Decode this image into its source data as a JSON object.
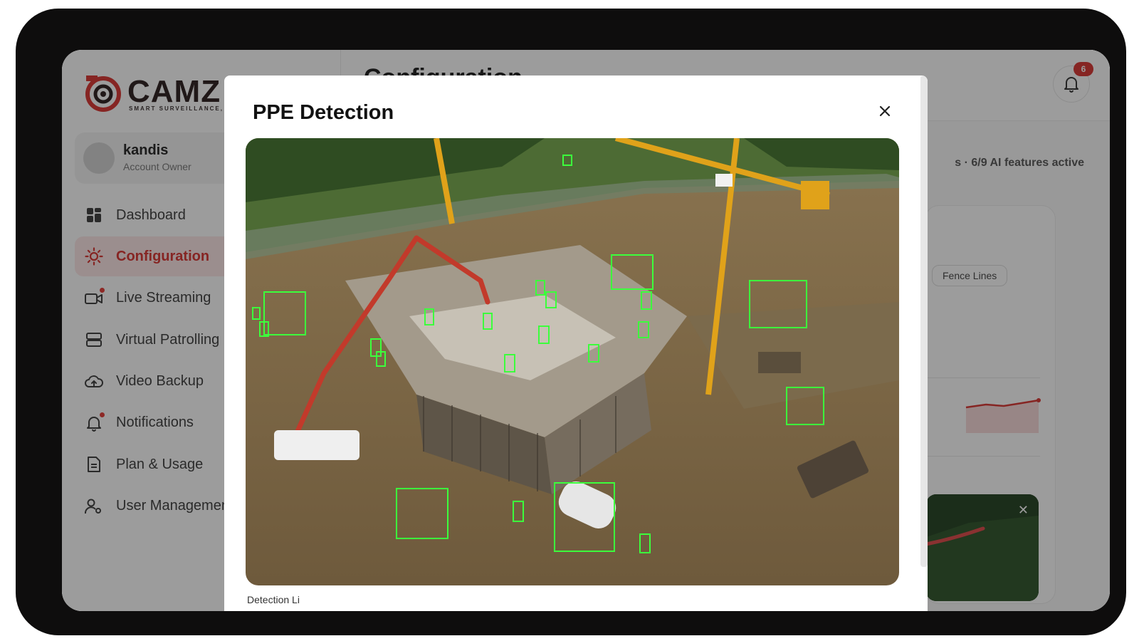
{
  "brand": {
    "name": "CAMZ",
    "tagline": "SMART SURVEILLANCE, S"
  },
  "account": {
    "name": "kandis",
    "role": "Account Owner"
  },
  "nav": [
    {
      "label": "Dashboard",
      "icon": "dashboard-icon",
      "active": false
    },
    {
      "label": "Configuration",
      "icon": "gear-icon",
      "active": true
    },
    {
      "label": "Live Streaming",
      "icon": "video-camera-icon",
      "active": false,
      "dot": true
    },
    {
      "label": "Virtual Patrolling",
      "icon": "server-icon",
      "active": false
    },
    {
      "label": "Video Backup",
      "icon": "cloud-upload-icon",
      "active": false
    },
    {
      "label": "Notifications",
      "icon": "bell-icon",
      "active": false,
      "dot": true
    },
    {
      "label": "Plan & Usage",
      "icon": "document-icon",
      "active": false
    },
    {
      "label": "User Managemen",
      "icon": "user-settings-icon",
      "active": false
    }
  ],
  "header": {
    "title": "Configuration",
    "notification_count": "6"
  },
  "status": {
    "features_text": "s · 6/9 AI features active"
  },
  "panel": {
    "chip_label": "Fence Lines"
  },
  "modal": {
    "title": "PPE Detection",
    "footer_text": "Detection Li"
  },
  "colors": {
    "accent": "#d9322f",
    "detection_box": "#3cff3c",
    "crane": "#e0a21a"
  }
}
